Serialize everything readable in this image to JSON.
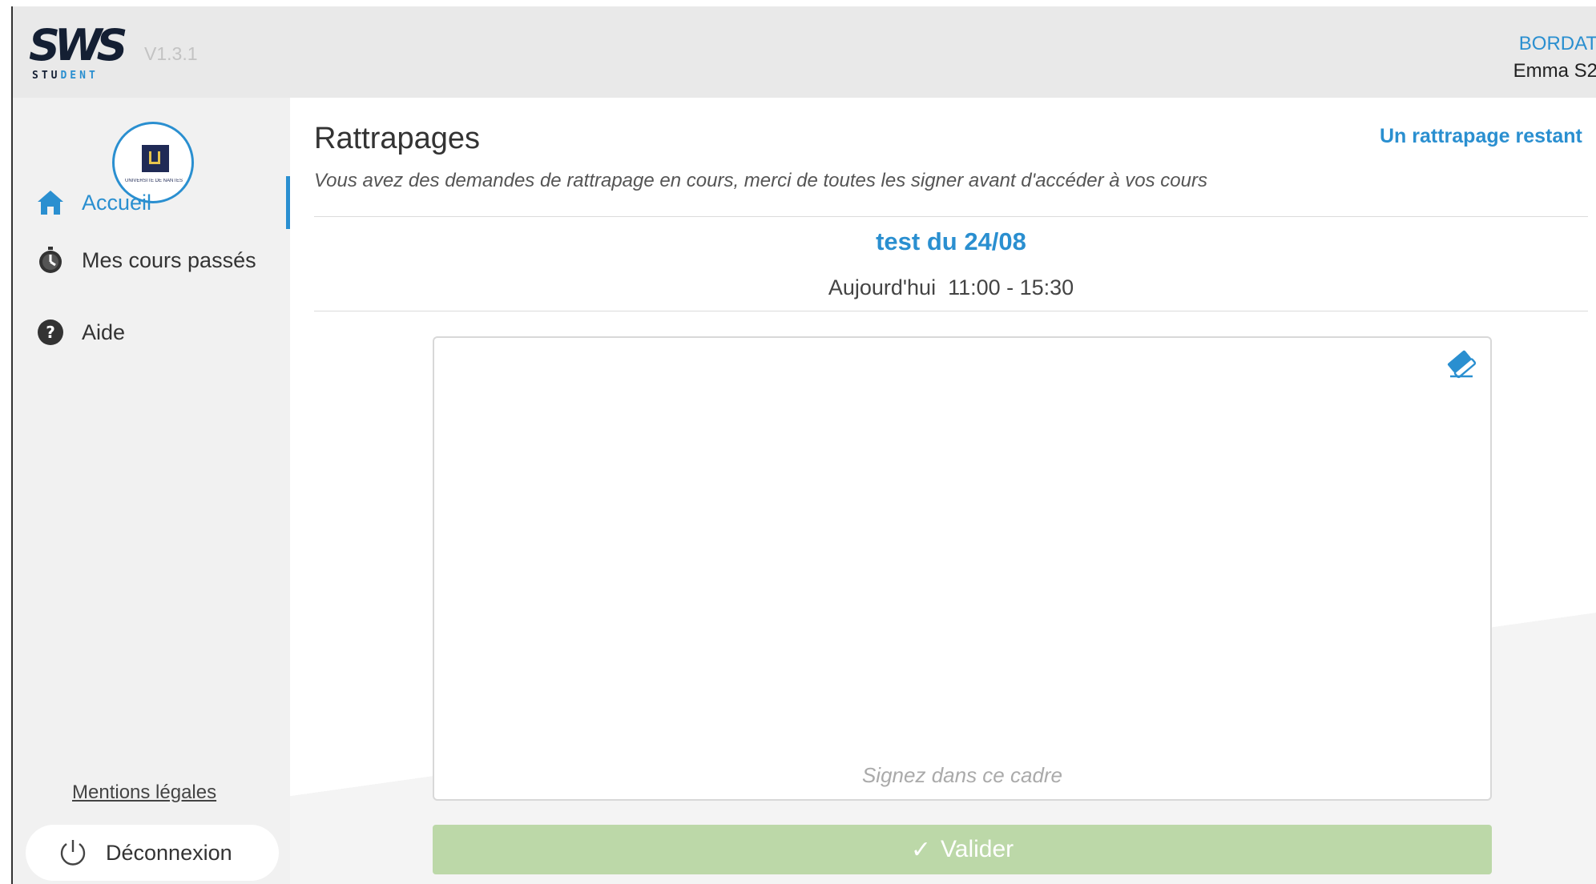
{
  "app": {
    "logo_text": "SWS",
    "logo_sub_a": "STU",
    "logo_sub_b": "DENT",
    "version": "V1.3.1"
  },
  "user": {
    "line1": "BORDAT",
    "line2": "Emma S2"
  },
  "sidebar": {
    "university_caption": "UNIVERSITÉ DE NANTES",
    "items": [
      {
        "label": "Accueil",
        "icon": "home-icon",
        "active": true
      },
      {
        "label": "Mes cours passés",
        "icon": "stopwatch-icon",
        "active": false
      },
      {
        "label": "Aide",
        "icon": "help-icon",
        "active": false
      }
    ],
    "legal_label": "Mentions légales",
    "logout_label": "Déconnexion"
  },
  "main": {
    "title": "Rattrapages",
    "subtitle": "Vous avez des demandes de rattrapage en cours, merci de toutes les signer avant d'accéder à vos cours",
    "remaining": "Un rattrapage restant",
    "session_name": "test du 24/08",
    "session_time": "Aujourd'hui  11:00 - 15:30",
    "sign_hint": "Signez dans ce cadre",
    "validate_label": "Valider"
  },
  "colors": {
    "accent": "#2a8fd0",
    "validate_disabled": "#bcd8a8",
    "sidebar_bg": "#f1f1f1"
  }
}
